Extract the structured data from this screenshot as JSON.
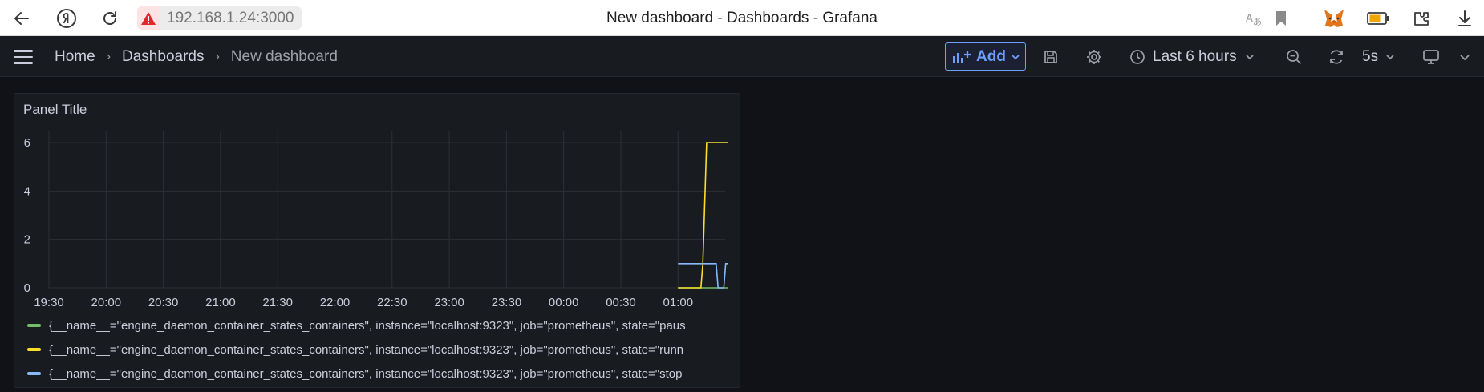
{
  "browser": {
    "address": "192.168.1.24:3000",
    "window_title": "New dashboard - Dashboards - Grafana"
  },
  "nav": {
    "breadcrumbs": [
      "Home",
      "Dashboards",
      "New dashboard"
    ],
    "add_label": "Add",
    "time_range": "Last 6 hours",
    "refresh_interval": "5s"
  },
  "panel": {
    "title": "Panel Title"
  },
  "colors": {
    "paused": "#73bf69",
    "running": "#fade2a",
    "stopped": "#8ab8ff",
    "accent": "#6e9fff"
  },
  "chart_data": {
    "type": "line",
    "title": "Panel Title",
    "xlabel": "",
    "ylabel": "",
    "x_ticks": [
      "19:30",
      "20:00",
      "20:30",
      "21:00",
      "21:30",
      "22:00",
      "22:30",
      "23:00",
      "23:30",
      "00:00",
      "00:30",
      "01:00"
    ],
    "y_ticks": [
      "0",
      "2",
      "4",
      "6"
    ],
    "ylim": [
      0,
      6
    ],
    "grid": true,
    "legend_position": "bottom",
    "series": [
      {
        "name": "{__name__=\"engine_daemon_container_states_containers\", instance=\"localhost:9323\", job=\"prometheus\", state=\"paus",
        "color": "#73bf69",
        "x": [
          "01:00",
          "01:26"
        ],
        "y": [
          0,
          0
        ]
      },
      {
        "name": "{__name__=\"engine_daemon_container_states_containers\", instance=\"localhost:9323\", job=\"prometheus\", state=\"runn",
        "color": "#fade2a",
        "x": [
          "01:00",
          "01:12",
          "01:13",
          "01:15",
          "01:26"
        ],
        "y": [
          0,
          0,
          1,
          6,
          6
        ]
      },
      {
        "name": "{__name__=\"engine_daemon_container_states_containers\", instance=\"localhost:9323\", job=\"prometheus\", state=\"stop",
        "color": "#8ab8ff",
        "x": [
          "01:00",
          "01:20",
          "01:21",
          "01:24",
          "01:25",
          "01:26"
        ],
        "y": [
          1,
          1,
          0,
          0,
          1,
          1
        ]
      }
    ]
  }
}
